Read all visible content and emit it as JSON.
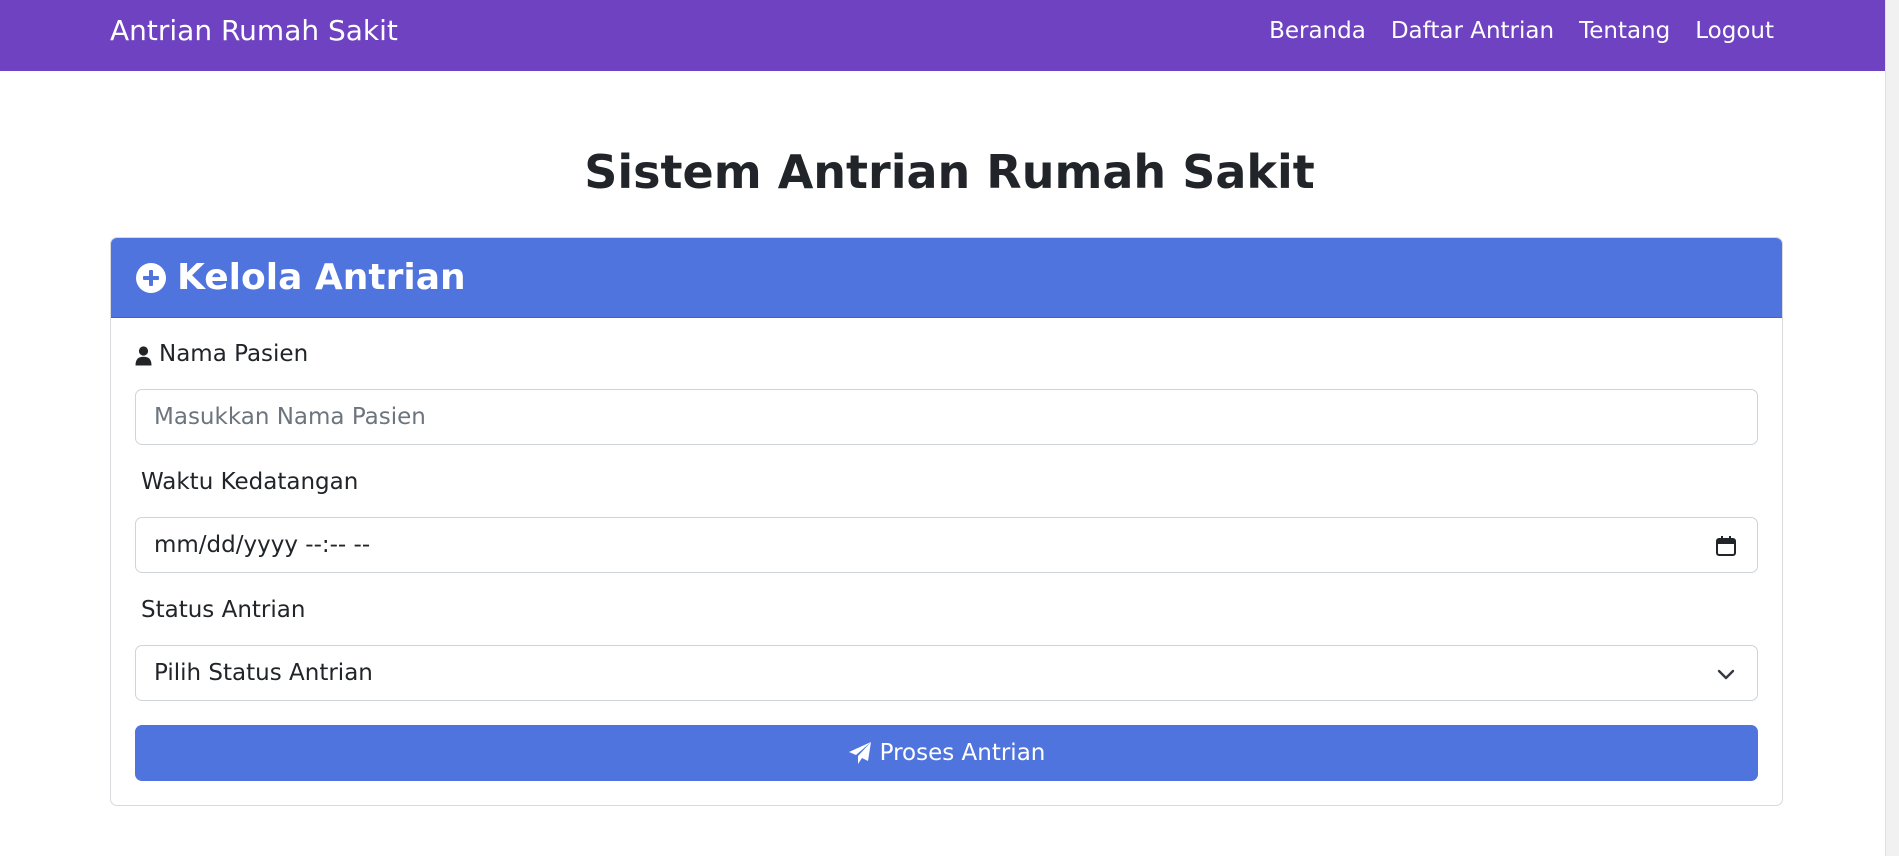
{
  "navbar": {
    "brand": "Antrian Rumah Sakit",
    "links": [
      "Beranda",
      "Daftar Antrian",
      "Tentang",
      "Logout"
    ]
  },
  "page": {
    "title": "Sistem Antrian Rumah Sakit"
  },
  "card": {
    "title": "Kelola Antrian",
    "title_icon": "plus-circle-icon"
  },
  "form": {
    "name_label": "Nama Pasien",
    "name_icon": "user-icon",
    "name_placeholder": "Masukkan Nama Pasien",
    "name_value": "",
    "time_label": "Waktu Kedatangan",
    "time_value": "mm/dd/yyyy --:-- --",
    "time_icon": "calendar-icon",
    "status_label": "Status Antrian",
    "status_selected": "Pilih Status Antrian",
    "status_icon": "chevron-down-icon",
    "submit_label": "Proses Antrian",
    "submit_icon": "paper-plane-icon"
  },
  "colors": {
    "navbar": "#6f42c1",
    "card_header": "#4f74de",
    "button": "#4f74de"
  }
}
